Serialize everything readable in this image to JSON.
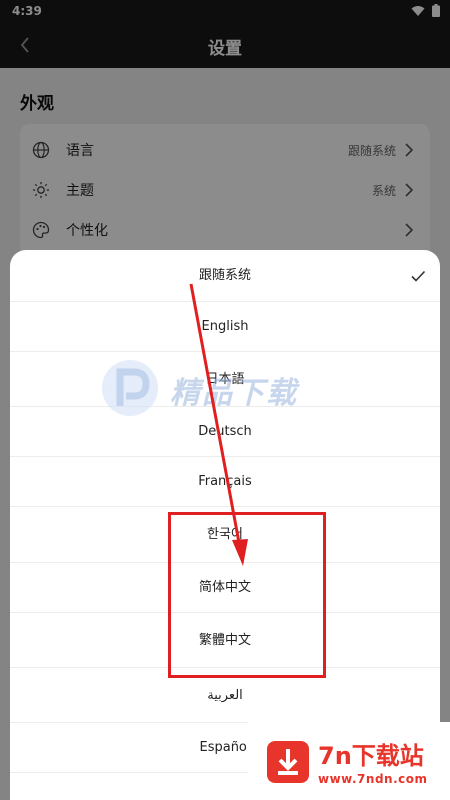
{
  "status_bar": {
    "time": "4:39"
  },
  "app_bar": {
    "title": "设置"
  },
  "section": {
    "title": "外观"
  },
  "settings": [
    {
      "label": "语言",
      "value": "跟随系统",
      "icon": "globe-icon"
    },
    {
      "label": "主题",
      "value": "系统",
      "icon": "sun-icon"
    },
    {
      "label": "个性化",
      "value": "",
      "icon": "palette-icon"
    }
  ],
  "language_sheet": {
    "selected_index": 0,
    "options": [
      "跟随系统",
      "English",
      "日本語",
      "Deutsch",
      "Français",
      "한국어",
      "简体中文",
      "繁體中文",
      "العربية",
      "Español"
    ]
  },
  "watermark": {
    "text": "精品下载"
  },
  "brand": {
    "name": "7n下载站",
    "url": "www.7ndn.com"
  },
  "colors": {
    "annotation": "#e02020",
    "brand": "#e8352c",
    "dark_bar": "#181818"
  }
}
